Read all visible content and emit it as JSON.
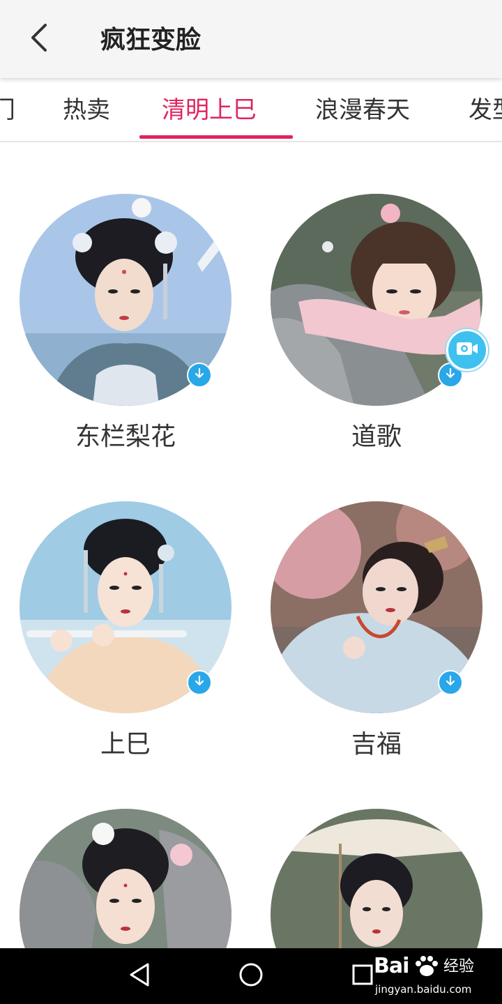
{
  "header": {
    "title": "疯狂变脸",
    "back_icon": "back-arrow-icon"
  },
  "tabs": {
    "items": [
      {
        "label": "门",
        "active": false
      },
      {
        "label": "热卖",
        "active": false
      },
      {
        "label": "清明上巳",
        "active": true
      },
      {
        "label": "浪漫春天",
        "active": false
      },
      {
        "label": "发型",
        "active": false
      }
    ],
    "accent_color": "#e0245e"
  },
  "templates": [
    {
      "name": "东栏梨花",
      "badge": "download-icon"
    },
    {
      "name": "道歌",
      "badge": "download-icon",
      "extra_badge": "video-camera-icon"
    },
    {
      "name": "上巳",
      "badge": "download-icon"
    },
    {
      "name": "吉福",
      "badge": "download-icon"
    },
    {
      "name": "",
      "badge": ""
    },
    {
      "name": "",
      "badge": ""
    }
  ],
  "navbar": {
    "buttons": [
      "back-triangle-icon",
      "home-circle-icon",
      "recents-square-icon"
    ]
  },
  "watermark": {
    "brand": "Bai",
    "brand_suffix": "经验",
    "url": "jingyan.baidu.com"
  }
}
